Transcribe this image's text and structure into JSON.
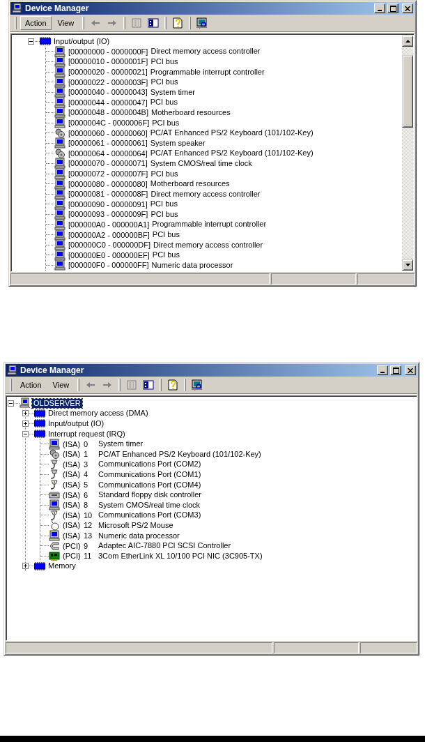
{
  "windows": [
    {
      "title": "Device Manager",
      "vertical_scrollbar": true,
      "menus": [
        {
          "label": "Action",
          "highlighted": true
        },
        {
          "label": "View",
          "highlighted": false
        }
      ],
      "toolbar": [
        {
          "kind": "back",
          "disabled": true
        },
        {
          "kind": "forward",
          "disabled": true
        },
        {
          "kind": "separator"
        },
        {
          "kind": "properties",
          "disabled": true
        },
        {
          "kind": "tree-toggle",
          "disabled": false
        },
        {
          "kind": "separator"
        },
        {
          "kind": "help",
          "disabled": false
        },
        {
          "kind": "separator"
        },
        {
          "kind": "scan",
          "disabled": false
        }
      ],
      "tree": [
        {
          "kind": "category",
          "label": "Input/output (IO)",
          "expanded": true,
          "selected": false,
          "children": [
            {
              "kind": "monitor",
              "range": "[00000000 - 0000000F]",
              "label": "Direct memory access controller",
              "selected": false
            },
            {
              "kind": "monitor",
              "range": "[00000010 - 0000001F]",
              "label": "PCI bus",
              "selected": false
            },
            {
              "kind": "monitor",
              "range": "[00000020 - 00000021]",
              "label": "Programmable interrupt controller",
              "selected": false
            },
            {
              "kind": "monitor",
              "range": "[00000022 - 0000003F]",
              "label": "PCI bus",
              "selected": false
            },
            {
              "kind": "monitor",
              "range": "[00000040 - 00000043]",
              "label": "System timer",
              "selected": false
            },
            {
              "kind": "monitor",
              "range": "[00000044 - 00000047]",
              "label": "PCI bus",
              "selected": false
            },
            {
              "kind": "monitor",
              "range": "[00000048 - 0000004B]",
              "label": "Motherboard resources",
              "selected": false
            },
            {
              "kind": "monitor",
              "range": "[0000004C - 0000006F]",
              "label": "PCI bus",
              "selected": false
            },
            {
              "kind": "keyboard",
              "range": "[00000060 - 00000060]",
              "label": "PC/AT Enhanced PS/2 Keyboard (101/102-Key)",
              "selected": false
            },
            {
              "kind": "monitor",
              "range": "[00000061 - 00000061]",
              "label": "System speaker",
              "selected": false
            },
            {
              "kind": "keyboard",
              "range": "[00000064 - 00000064]",
              "label": "PC/AT Enhanced PS/2 Keyboard (101/102-Key)",
              "selected": false
            },
            {
              "kind": "monitor",
              "range": "[00000070 - 00000071]",
              "label": "System CMOS/real time clock",
              "selected": false
            },
            {
              "kind": "monitor",
              "range": "[00000072 - 0000007F]",
              "label": "PCI bus",
              "selected": false
            },
            {
              "kind": "monitor",
              "range": "[00000080 - 00000080]",
              "label": "Motherboard resources",
              "selected": false
            },
            {
              "kind": "monitor",
              "range": "[00000081 - 0000008F]",
              "label": "Direct memory access controller",
              "selected": false
            },
            {
              "kind": "monitor",
              "range": "[00000090 - 00000091]",
              "label": "PCI bus",
              "selected": false
            },
            {
              "kind": "monitor",
              "range": "[00000093 - 0000009F]",
              "label": "PCI bus",
              "selected": false
            },
            {
              "kind": "monitor",
              "range": "[000000A0 - 000000A1]",
              "label": "Programmable interrupt controller",
              "selected": false
            },
            {
              "kind": "monitor",
              "range": "[000000A2 - 000000BF]",
              "label": "PCI bus",
              "selected": false
            },
            {
              "kind": "monitor",
              "range": "[000000C0 - 000000DF]",
              "label": "Direct memory access controller",
              "selected": false
            },
            {
              "kind": "monitor",
              "range": "[000000E0 - 000000EF]",
              "label": "PCI bus",
              "selected": false
            },
            {
              "kind": "monitor",
              "range": "[000000F0 - 000000FF]",
              "label": "Numeric data processor",
              "selected": false
            }
          ]
        }
      ]
    },
    {
      "title": "Device Manager",
      "vertical_scrollbar": false,
      "menus": [
        {
          "label": "Action",
          "highlighted": false
        },
        {
          "label": "View",
          "highlighted": false
        }
      ],
      "toolbar": [
        {
          "kind": "back",
          "disabled": true
        },
        {
          "kind": "forward",
          "disabled": true
        },
        {
          "kind": "separator"
        },
        {
          "kind": "properties",
          "disabled": true
        },
        {
          "kind": "tree-toggle",
          "disabled": false
        },
        {
          "kind": "separator"
        },
        {
          "kind": "help",
          "disabled": false
        },
        {
          "kind": "separator"
        },
        {
          "kind": "scan",
          "disabled": false
        }
      ],
      "tree": [
        {
          "kind": "computer",
          "label": "OLDSERVER",
          "expanded": true,
          "selected": true,
          "children": [
            {
              "kind": "category",
              "label": "Direct memory access (DMA)",
              "expanded": false,
              "selected": false
            },
            {
              "kind": "category",
              "label": "Input/output (IO)",
              "expanded": false,
              "selected": false
            },
            {
              "kind": "category",
              "label": "Interrupt request (IRQ)",
              "expanded": true,
              "selected": false,
              "children": [
                {
                  "kind": "monitor",
                  "bus": "(ISA)",
                  "number": "0",
                  "label": "System timer",
                  "selected": false
                },
                {
                  "kind": "keyboard",
                  "bus": "(ISA)",
                  "number": "1",
                  "label": "PC/AT Enhanced PS/2 Keyboard (101/102-Key)",
                  "selected": false
                },
                {
                  "kind": "port",
                  "bus": "(ISA)",
                  "number": "3",
                  "label": "Communications Port (COM2)",
                  "selected": false
                },
                {
                  "kind": "port",
                  "bus": "(ISA)",
                  "number": "4",
                  "label": "Communications Port (COM1)",
                  "selected": false
                },
                {
                  "kind": "port-info",
                  "bus": "(ISA)",
                  "number": "5",
                  "label": "Communications Port (COM4)",
                  "selected": false
                },
                {
                  "kind": "floppy",
                  "bus": "(ISA)",
                  "number": "6",
                  "label": "Standard floppy disk controller",
                  "selected": false
                },
                {
                  "kind": "monitor",
                  "bus": "(ISA)",
                  "number": "8",
                  "label": "System CMOS/real time clock",
                  "selected": false
                },
                {
                  "kind": "port-info",
                  "bus": "(ISA)",
                  "number": "10",
                  "label": "Communications Port (COM3)",
                  "selected": false
                },
                {
                  "kind": "mouse",
                  "bus": "(ISA)",
                  "number": "12",
                  "label": "Microsoft PS/2 Mouse",
                  "selected": false
                },
                {
                  "kind": "monitor",
                  "bus": "(ISA)",
                  "number": "13",
                  "label": "Numeric data processor",
                  "selected": false
                },
                {
                  "kind": "scsi",
                  "bus": "(PCI)",
                  "number": "9",
                  "label": "Adaptec AIC-7880 PCI SCSI Controller",
                  "selected": false
                },
                {
                  "kind": "nic",
                  "bus": "(PCI)",
                  "number": "11",
                  "label": "3Com EtherLink XL 10/100 PCI NIC (3C905-TX)",
                  "selected": false
                }
              ]
            },
            {
              "kind": "category",
              "label": "Memory",
              "expanded": false,
              "selected": false
            }
          ]
        }
      ]
    }
  ]
}
